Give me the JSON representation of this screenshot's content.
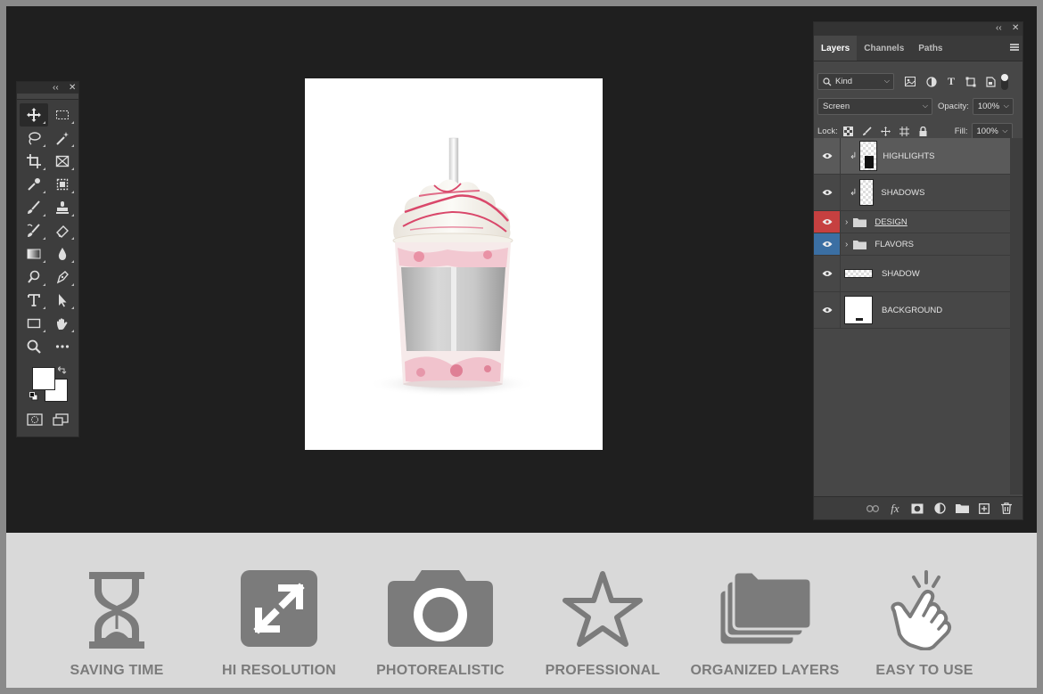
{
  "layers_panel": {
    "tabs": [
      {
        "label": "Layers",
        "active": true
      },
      {
        "label": "Channels",
        "active": false
      },
      {
        "label": "Paths",
        "active": false
      }
    ],
    "filter": {
      "value": "Kind"
    },
    "blend_mode": {
      "value": "Screen"
    },
    "opacity": {
      "label": "Opacity:",
      "value": "100%"
    },
    "lock": {
      "label": "Lock:"
    },
    "fill": {
      "label": "Fill:",
      "value": "100%"
    },
    "layers": [
      {
        "name": "HIGHLIGHTS",
        "selected": true,
        "clipped": true
      },
      {
        "name": "SHADOWS",
        "selected": false,
        "clipped": true
      },
      {
        "name": "DESIGN",
        "group": true,
        "color": "#c64040"
      },
      {
        "name": "FLAVORS",
        "group": true,
        "color": "#3b6fa3"
      },
      {
        "name": "SHADOW",
        "selected": false
      },
      {
        "name": "BACKGROUND",
        "selected": false
      }
    ]
  },
  "features": [
    {
      "label": "SAVING TIME",
      "icon": "hourglass-icon"
    },
    {
      "label": "HI RESOLUTION",
      "icon": "expand-arrows-icon"
    },
    {
      "label": "PHOTOREALISTIC",
      "icon": "camera-icon"
    },
    {
      "label": "PROFESSIONAL",
      "icon": "star-icon"
    },
    {
      "label": "ORGANIZED LAYERS",
      "icon": "folders-icon"
    },
    {
      "label": "EASY TO USE",
      "icon": "tap-hand-icon"
    }
  ],
  "colors": {
    "workspace": "#1f1f1f",
    "panel": "#474747",
    "feature_gray": "#7b7b7b",
    "band": "#d9d9d9"
  }
}
